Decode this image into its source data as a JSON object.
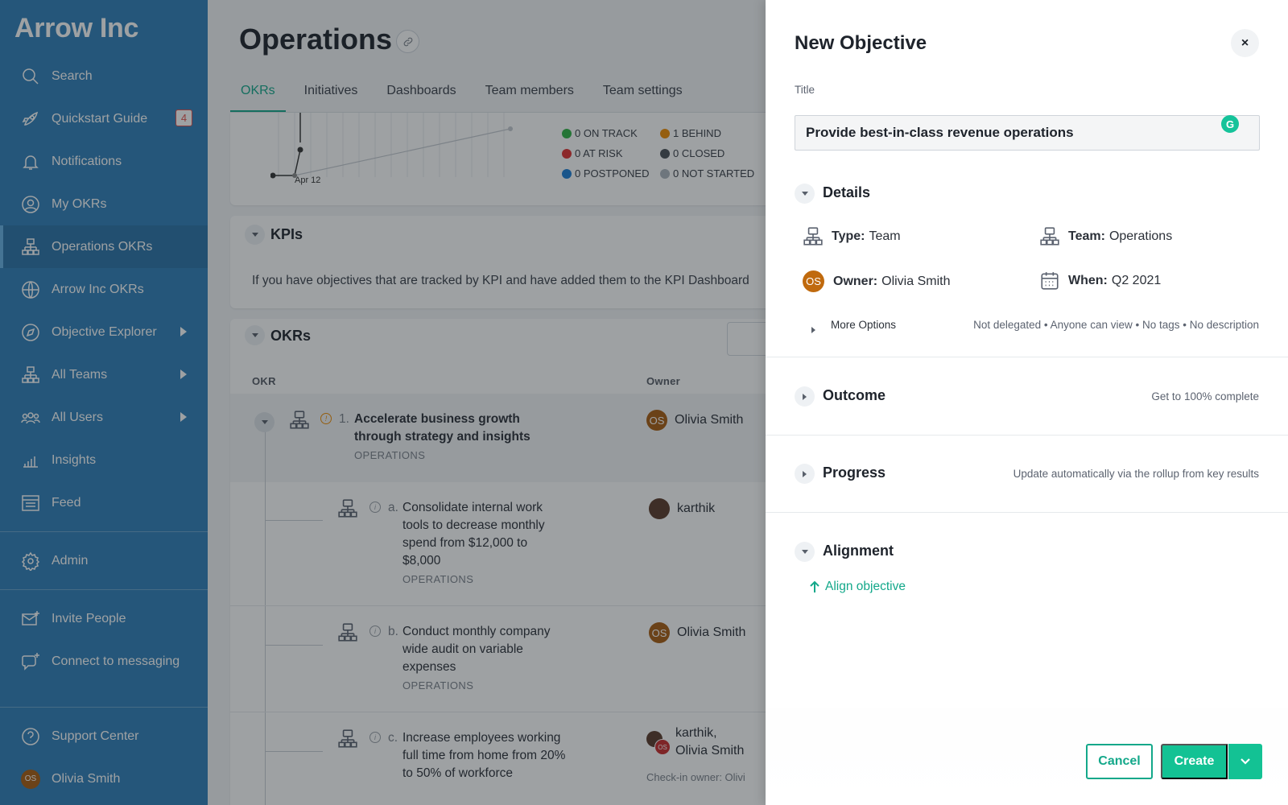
{
  "sidebar": {
    "brand": "Arrow Inc",
    "items": [
      {
        "label": "Search"
      },
      {
        "label": "Quickstart Guide",
        "badge": "4"
      },
      {
        "label": "Notifications"
      },
      {
        "label": "My OKRs"
      },
      {
        "label": "Operations OKRs"
      },
      {
        "label": "Arrow Inc OKRs"
      },
      {
        "label": "Objective Explorer"
      },
      {
        "label": "All Teams"
      },
      {
        "label": "All Users"
      },
      {
        "label": "Insights"
      },
      {
        "label": "Feed"
      },
      {
        "label": "Admin"
      },
      {
        "label": "Invite People"
      },
      {
        "label": "Connect to messaging"
      },
      {
        "label": "Support Center"
      },
      {
        "label": "Olivia Smith",
        "initials": "OS"
      }
    ]
  },
  "main": {
    "title": "Operations",
    "tabs": [
      "OKRs",
      "Initiatives",
      "Dashboards",
      "Team members",
      "Team settings"
    ],
    "chart": {
      "x_label": "Apr 12",
      "legend": [
        "0 ON TRACK",
        "1 BEHIND",
        "0 AT RISK",
        "0 CLOSED",
        "0 POSTPONED",
        "0 NOT STARTED"
      ]
    },
    "kpis": {
      "title": "KPIs",
      "text": "If you have objectives that are tracked by KPI and have added them to the KPI Dashboard"
    },
    "okrs": {
      "title": "OKRs",
      "col_okr": "OKR",
      "col_owner": "Owner",
      "rows": [
        {
          "num": "1.",
          "text": "Accelerate business growth through strategy and insights",
          "team": "OPERATIONS",
          "owner": "Olivia Smith",
          "initials": "OS"
        },
        {
          "num": "a.",
          "text": "Consolidate internal work tools to decrease monthly spend from $12,000 to $8,000",
          "team": "OPERATIONS",
          "owner": "karthik"
        },
        {
          "num": "b.",
          "text": "Conduct monthly company wide audit on variable expenses",
          "team": "OPERATIONS",
          "owner": "Olivia Smith",
          "initials": "OS"
        },
        {
          "num": "c.",
          "text": "Increase employees working full time from home from 20% to 50% of workforce",
          "team": "OPERATIONS",
          "owner_line1": "karthik,",
          "owner_line2": "Olivia Smith",
          "checkin": "Check-in owner: Olivi"
        }
      ]
    }
  },
  "panel": {
    "title": "New Objective",
    "close": "×",
    "title_label": "Title",
    "title_value": "Provide best-in-class revenue operations",
    "details": {
      "heading": "Details",
      "type_label": "Type:",
      "type_value": "Team",
      "team_label": "Team:",
      "team_value": "Operations",
      "owner_label": "Owner:",
      "owner_value": "Olivia Smith",
      "owner_initials": "OS",
      "when_label": "When:",
      "when_value": "Q2 2021",
      "more_options": "More Options",
      "more_meta": "Not delegated • Anyone can view • No tags • No description"
    },
    "outcome": {
      "heading": "Outcome",
      "meta": "Get to 100% complete"
    },
    "progress": {
      "heading": "Progress",
      "meta": "Update automatically via the rollup from key results"
    },
    "alignment": {
      "heading": "Alignment",
      "link": "Align objective"
    },
    "cancel": "Cancel",
    "create": "Create"
  },
  "colors": {
    "sidebar": "#2f7fb8",
    "accent": "#13a88a",
    "create": "#13c294",
    "avatar": "#a85c10"
  }
}
